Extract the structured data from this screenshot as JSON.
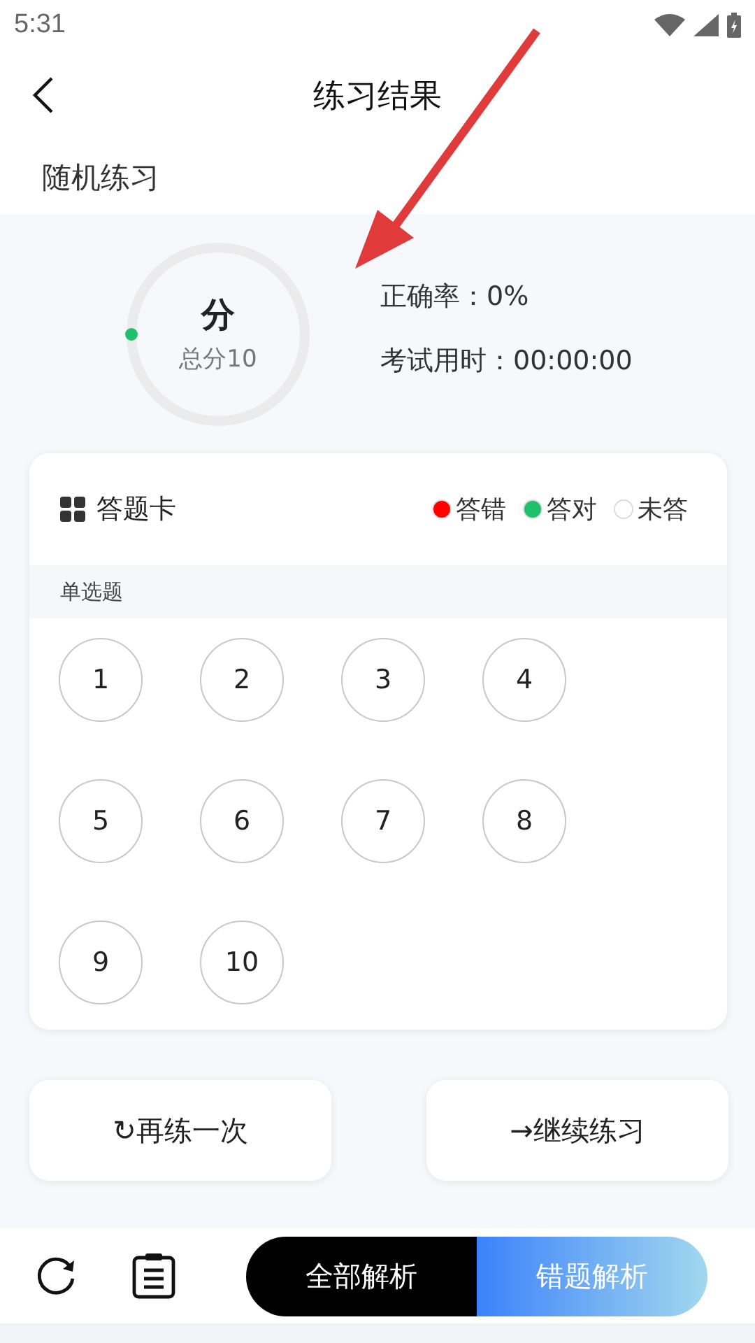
{
  "status_bar": {
    "time": "5:31"
  },
  "header": {
    "title": "练习结果"
  },
  "subtitle": "随机练习",
  "score": {
    "value": "分",
    "total": "总分10",
    "level": 0
  },
  "stats": [
    "正确率：0%",
    "考试用时：00:00:00"
  ],
  "answer_card": {
    "title": "答题卡",
    "legend": [
      {
        "label": "答错",
        "color": "#ff0000"
      },
      {
        "label": "答对",
        "color": "#1fc06b"
      },
      {
        "label": "未答",
        "color": "#ffffff"
      }
    ],
    "sections": [
      {
        "title": "单选题",
        "questions": [
          {
            "number": "1",
            "kind": "unanswered"
          },
          {
            "number": "2",
            "kind": "unanswered"
          },
          {
            "number": "3",
            "kind": "unanswered"
          },
          {
            "number": "4",
            "kind": "unanswered"
          },
          {
            "number": "5",
            "kind": "unanswered"
          },
          {
            "number": "6",
            "kind": "unanswered"
          },
          {
            "number": "7",
            "kind": "unanswered"
          },
          {
            "number": "8",
            "kind": "unanswered"
          },
          {
            "number": "9",
            "kind": "unanswered"
          },
          {
            "number": "10",
            "kind": "unanswered"
          }
        ]
      }
    ]
  },
  "actions": [
    {
      "icon": "↻",
      "label": "再练一次"
    },
    {
      "icon": "→",
      "label": "继续练习"
    }
  ],
  "bottom_bar": {
    "tabs": [
      {
        "label": "全部解析",
        "selected": false
      },
      {
        "label": "错题解析",
        "selected": true
      }
    ]
  },
  "annotation": {
    "kind": "arrow"
  }
}
